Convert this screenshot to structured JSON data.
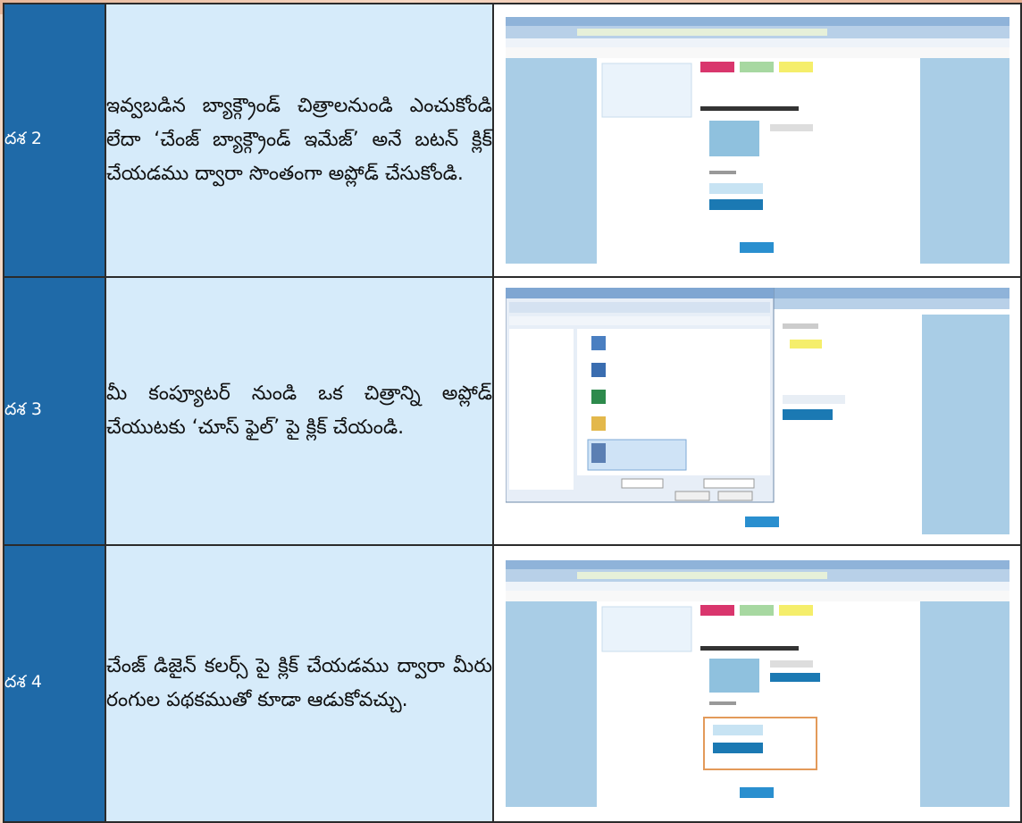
{
  "steps": [
    {
      "label": "దశ 2",
      "text": "ఇవ్వబడిన బ్యాక్గ్రౌండ్ చిత్రాలనుండి ఎంచుకోండి లేదా ‘చేంజ్ బ్యాక్గ్రౌండ్ ఇమేజ్’ అనే బటన్ క్లిక్ చేయడము ద్వారా సొంతంగా అప్లోడ్ చేసుకోండి.",
      "screenshot_icon": "twitter-settings-background-screenshot"
    },
    {
      "label": "దశ 3",
      "text": "మీ కంప్యూటర్ నుండి ఒక చిత్రాన్ని అప్లోడ్ చేయుటకు ‘చూస్ ఫైల్’ పై క్లిక్ చేయండి.",
      "screenshot_icon": "choose-file-dialog-screenshot"
    },
    {
      "label": "దశ 4",
      "text": "చేంజ్ డిజైన్ కలర్స్ పై క్లిక్ చేయడము ద్వారా మీరు రంగుల పథకముతో కూడా ఆడుకోవచ్చు.",
      "screenshot_icon": "design-colors-screenshot"
    }
  ],
  "colors": {
    "label_bg": "#1f6aa8",
    "text_bg": "#d6ebfa",
    "border": "#2b2b2b"
  }
}
